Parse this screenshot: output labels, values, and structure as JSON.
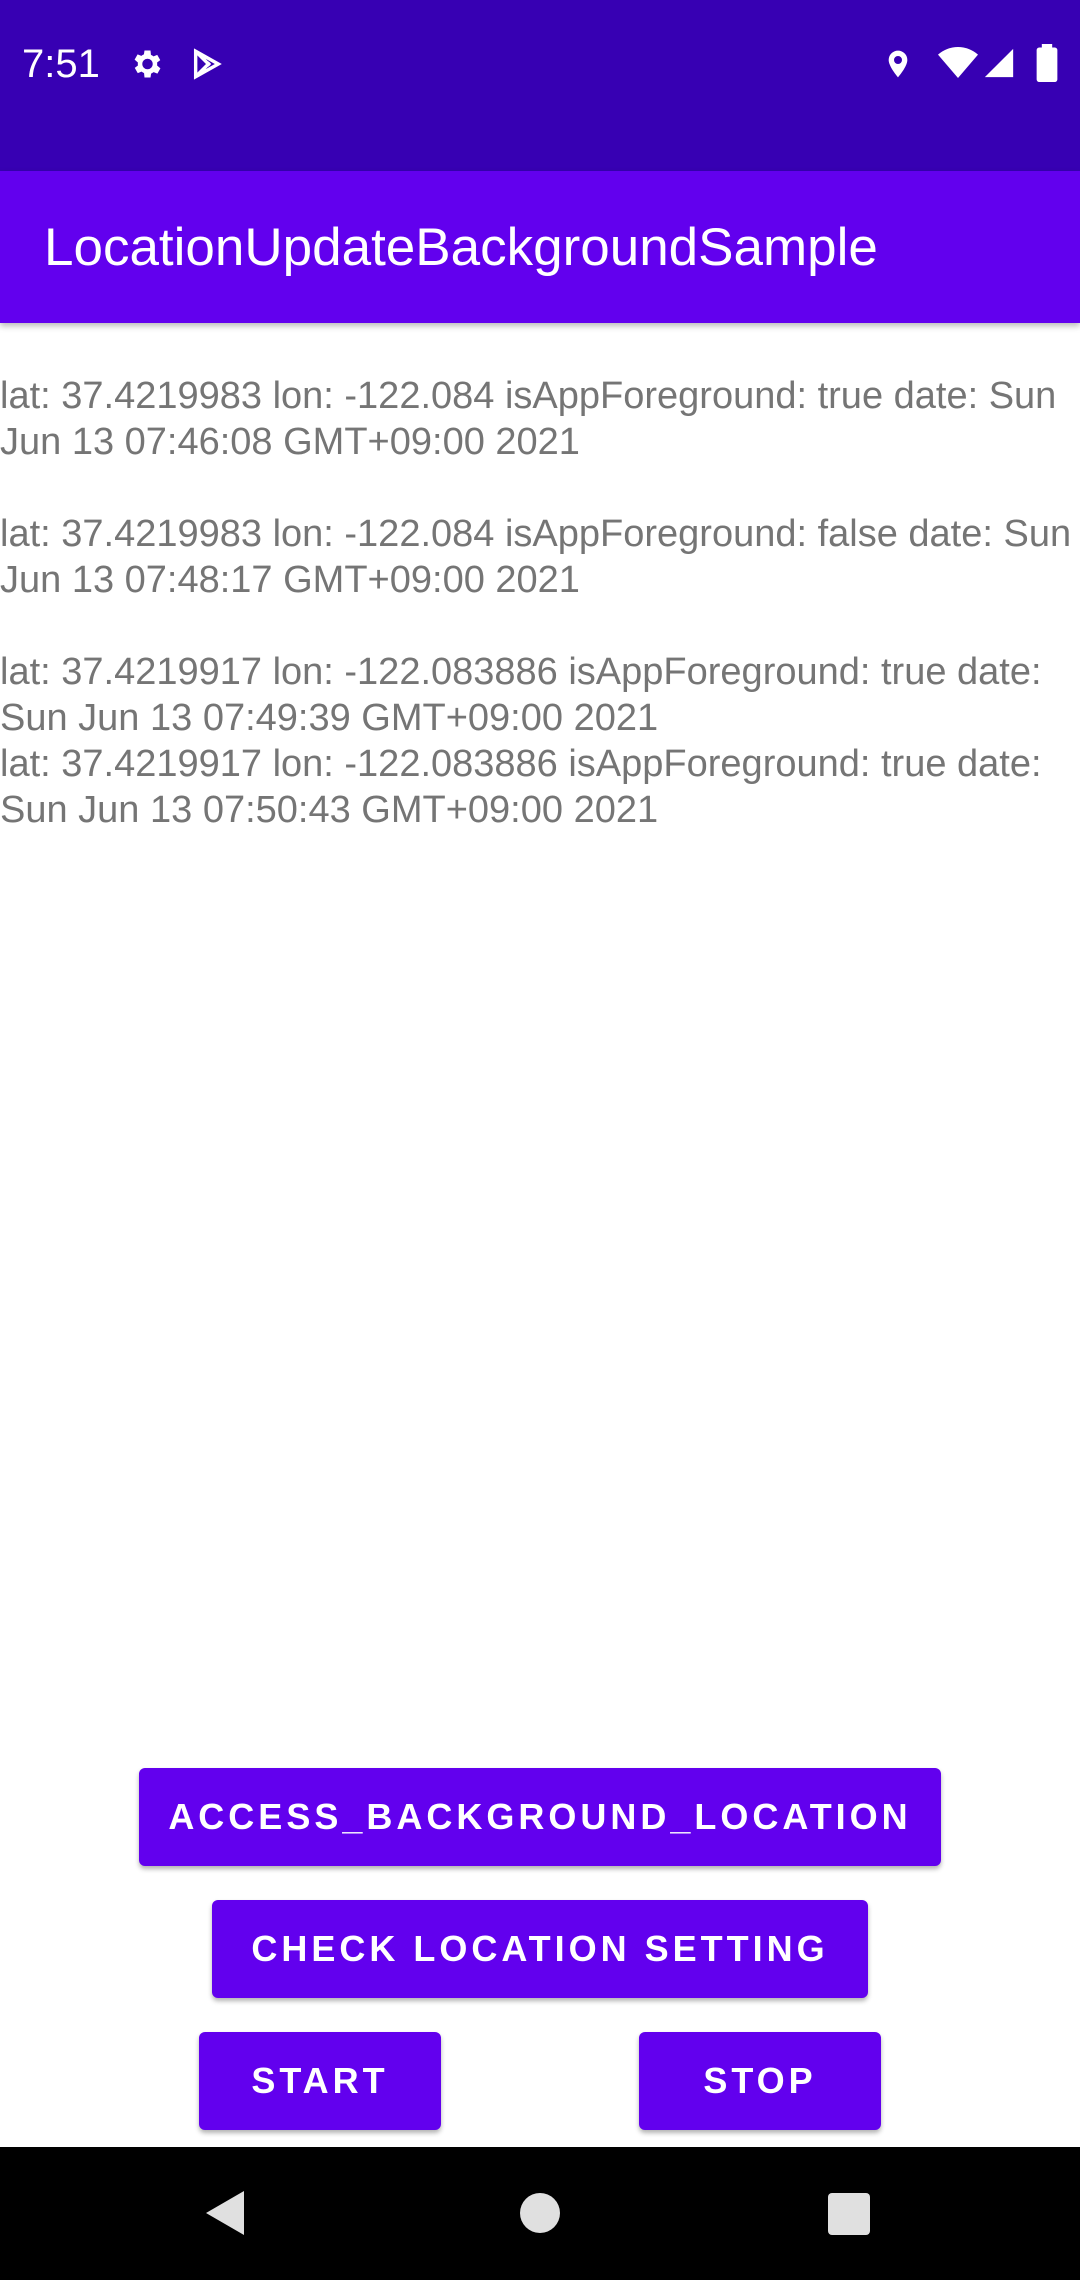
{
  "status_bar": {
    "time": "7:51",
    "icons": [
      "gear-icon",
      "play-store-icon",
      "location-pin-icon",
      "wifi-icon",
      "cellular-signal-icon",
      "battery-icon"
    ]
  },
  "app_bar": {
    "title": "LocationUpdateBackgroundSample"
  },
  "log": {
    "entries": [
      "lat: 37.4219983 lon: -122.084 isAppForeground: true date: Sun Jun 13 07:46:08 GMT+09:00 2021",
      "lat: 37.4219983 lon: -122.084 isAppForeground: false date: Sun Jun 13 07:48:17 GMT+09:00 2021",
      "lat: 37.4219917 lon: -122.083886 isAppForeground: true date: Sun Jun 13 07:49:39 GMT+09:00 2021",
      "lat: 37.4219917 lon: -122.083886 isAppForeground: true date: Sun Jun 13 07:50:43 GMT+09:00 2021"
    ]
  },
  "buttons": {
    "access_background_location": "ACCESS_BACKGROUND_LOCATION",
    "check_location_setting": "CHECK LOCATION SETTING",
    "start": "START",
    "stop": "STOP"
  },
  "colors": {
    "status_bar": "#3700b3",
    "app_bar": "#6200ee",
    "button": "#6200ee",
    "log_text": "#757575"
  },
  "nav_bar": {
    "icons": [
      "back-icon",
      "home-icon",
      "recents-icon"
    ]
  }
}
